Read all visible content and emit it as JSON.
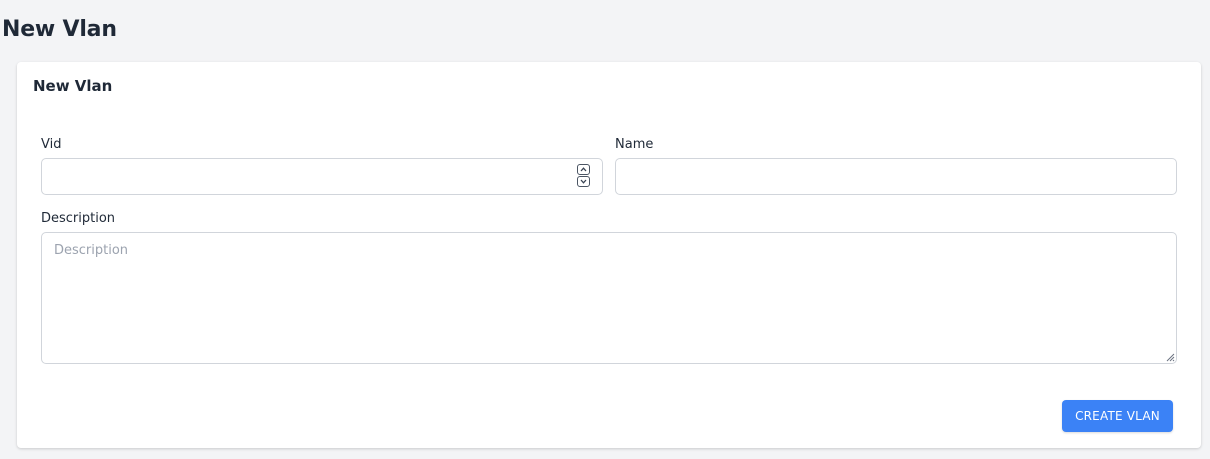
{
  "page": {
    "title": "New Vlan"
  },
  "card": {
    "title": "New Vlan"
  },
  "form": {
    "vid": {
      "label": "Vid",
      "value": "",
      "placeholder": ""
    },
    "name": {
      "label": "Name",
      "value": "",
      "placeholder": ""
    },
    "description": {
      "label": "Description",
      "value": "",
      "placeholder": "Description"
    },
    "submit_label": "CREATE VLAN"
  },
  "colors": {
    "accent": "#3b82f6",
    "page_background": "#f3f4f6",
    "card_background": "#ffffff",
    "border": "#d1d5db"
  },
  "icons": {
    "spinner_up": "chevron-up-icon",
    "spinner_down": "chevron-down-icon",
    "resize": "resize-handle-icon"
  }
}
